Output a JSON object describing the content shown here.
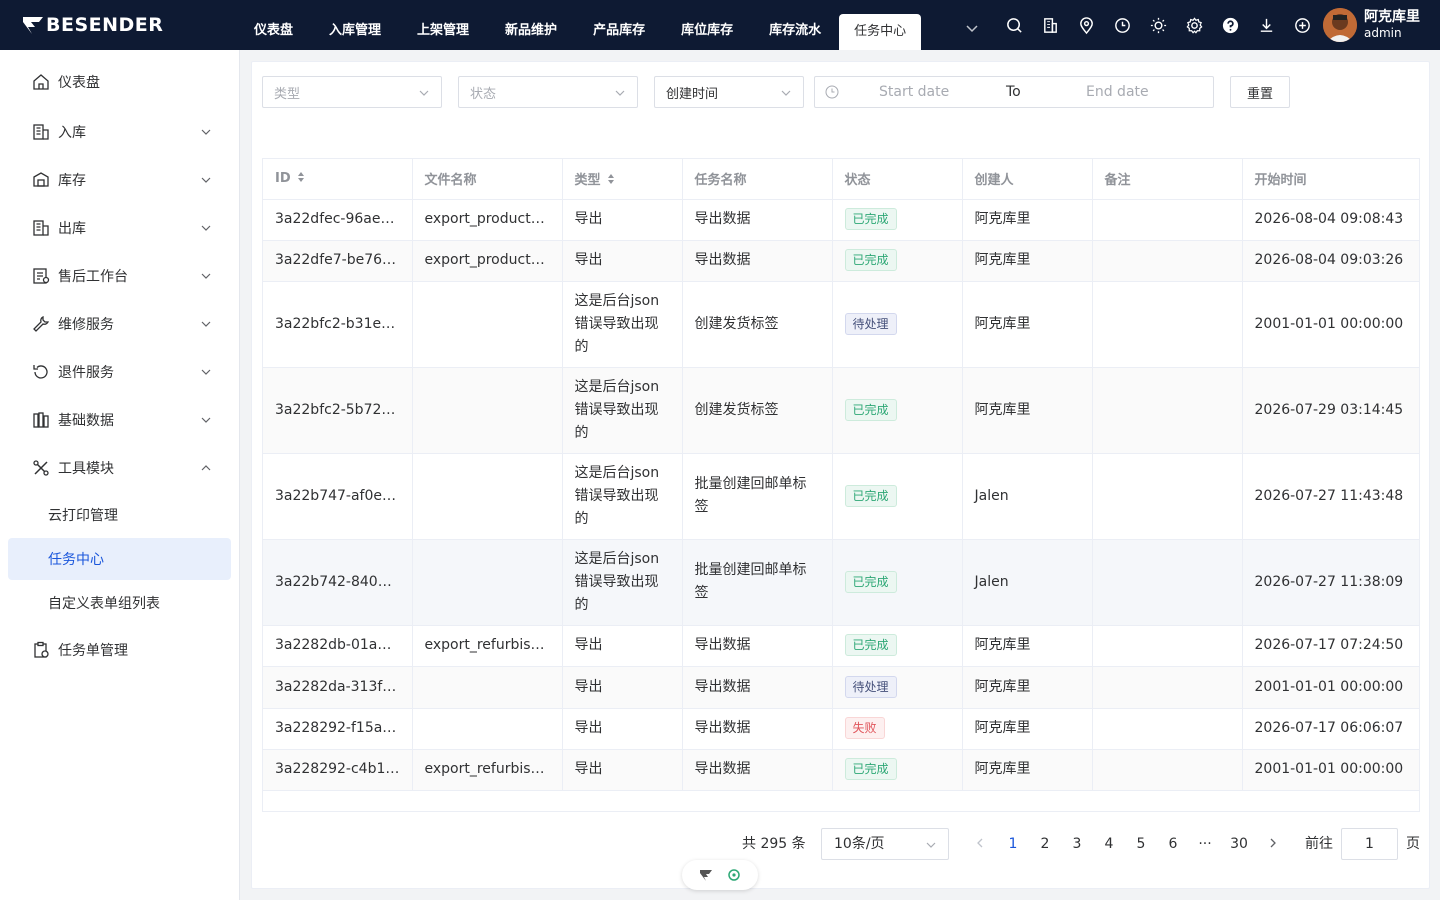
{
  "brand": {
    "logo_text": "BESENDER",
    "nav_bg": "#0e1a33",
    "accent": "#1a56db"
  },
  "nav": {
    "items": [
      "仪表盘",
      "入库管理",
      "上架管理",
      "新品维护",
      "产品库存",
      "库位库存",
      "库存流水",
      "任务中心"
    ],
    "active": "任务中心"
  },
  "toolbar_icons": [
    "search-icon",
    "building-icon",
    "location-icon",
    "clock-icon",
    "sun-icon",
    "gear-icon",
    "help-icon",
    "download-icon",
    "add-circle-icon"
  ],
  "user": {
    "name": "阿克库里",
    "role": "admin"
  },
  "sidebar": {
    "items": [
      {
        "label": "仪表盘",
        "icon": "home-icon"
      },
      {
        "label": "入库",
        "icon": "warehouse-in-icon"
      },
      {
        "label": "库存",
        "icon": "inventory-icon"
      },
      {
        "label": "出库",
        "icon": "warehouse-out-icon"
      },
      {
        "label": "售后工作台",
        "icon": "aftersale-icon"
      },
      {
        "label": "维修服务",
        "icon": "wrench-icon"
      },
      {
        "label": "退件服务",
        "icon": "return-icon"
      },
      {
        "label": "基础数据",
        "icon": "database-icon"
      },
      {
        "label": "工具模块",
        "icon": "tools-icon"
      }
    ],
    "tool_sub": [
      "云打印管理",
      "任务中心",
      "自定义表单组列表"
    ],
    "last": {
      "label": "任务单管理",
      "icon": "task-order-icon"
    }
  },
  "filters": {
    "type_placeholder": "类型",
    "status_placeholder": "状态",
    "time_field": "创建时间",
    "start_placeholder": "Start date",
    "range_sep": "To",
    "end_placeholder": "End date",
    "reset": "重置"
  },
  "table": {
    "columns": [
      "ID",
      "文件名称",
      "类型",
      "任务名称",
      "状态",
      "创建人",
      "备注",
      "开始时间"
    ],
    "rows": [
      {
        "id": "3a22dfec-96ae…",
        "file": "export_products…",
        "type": "导出",
        "task": "导出数据",
        "status": "已完成",
        "creator": "阿克库里",
        "remark": "",
        "start": "2026-08-04 09:08:43"
      },
      {
        "id": "3a22dfe7-be76…",
        "file": "export_products…",
        "type": "导出",
        "task": "导出数据",
        "status": "已完成",
        "creator": "阿克库里",
        "remark": "",
        "start": "2026-08-04 09:03:26"
      },
      {
        "id": "3a22bfc2-b31e-…",
        "file": "",
        "type": "这是后台json错误导致出现的",
        "task": "创建发货标签",
        "status": "待处理",
        "creator": "阿克库里",
        "remark": "",
        "start": "2001-01-01 00:00:00"
      },
      {
        "id": "3a22bfc2-5b72…",
        "file": "",
        "type": "这是后台json错误导致出现的",
        "task": "创建发货标签",
        "status": "已完成",
        "creator": "阿克库里",
        "remark": "",
        "start": "2026-07-29 03:14:45"
      },
      {
        "id": "3a22b747-af0e…",
        "file": "",
        "type": "这是后台json错误导致出现的",
        "task": "批量创建回邮单标签",
        "status": "已完成",
        "creator": "Jalen",
        "remark": "",
        "start": "2026-07-27 11:43:48"
      },
      {
        "id": "3a22b742-8405…",
        "file": "",
        "type": "这是后台json错误导致出现的",
        "task": "批量创建回邮单标签",
        "status": "已完成",
        "creator": "Jalen",
        "remark": "",
        "start": "2026-07-27 11:38:09"
      },
      {
        "id": "3a2282db-01a8…",
        "file": "export_refurbish…",
        "type": "导出",
        "task": "导出数据",
        "status": "已完成",
        "creator": "阿克库里",
        "remark": "",
        "start": "2026-07-17 07:24:50"
      },
      {
        "id": "3a2282da-313f…",
        "file": "",
        "type": "导出",
        "task": "导出数据",
        "status": "待处理",
        "creator": "阿克库里",
        "remark": "",
        "start": "2001-01-01 00:00:00"
      },
      {
        "id": "3a228292-f15a…",
        "file": "",
        "type": "导出",
        "task": "导出数据",
        "status": "失败",
        "creator": "阿克库里",
        "remark": "",
        "start": "2026-07-17 06:06:07"
      },
      {
        "id": "3a228292-c4b1…",
        "file": "export_refurbish…",
        "type": "导出",
        "task": "导出数据",
        "status": "已完成",
        "creator": "阿克库里",
        "remark": "",
        "start": "2001-01-01 00:00:00"
      }
    ]
  },
  "pagination": {
    "total": "共 295 条",
    "page_size": "10条/页",
    "pages": [
      "1",
      "2",
      "3",
      "4",
      "5",
      "6",
      "···",
      "30"
    ],
    "current": "1",
    "goto_label": "前往",
    "goto_value": "1",
    "page_suffix": "页"
  }
}
